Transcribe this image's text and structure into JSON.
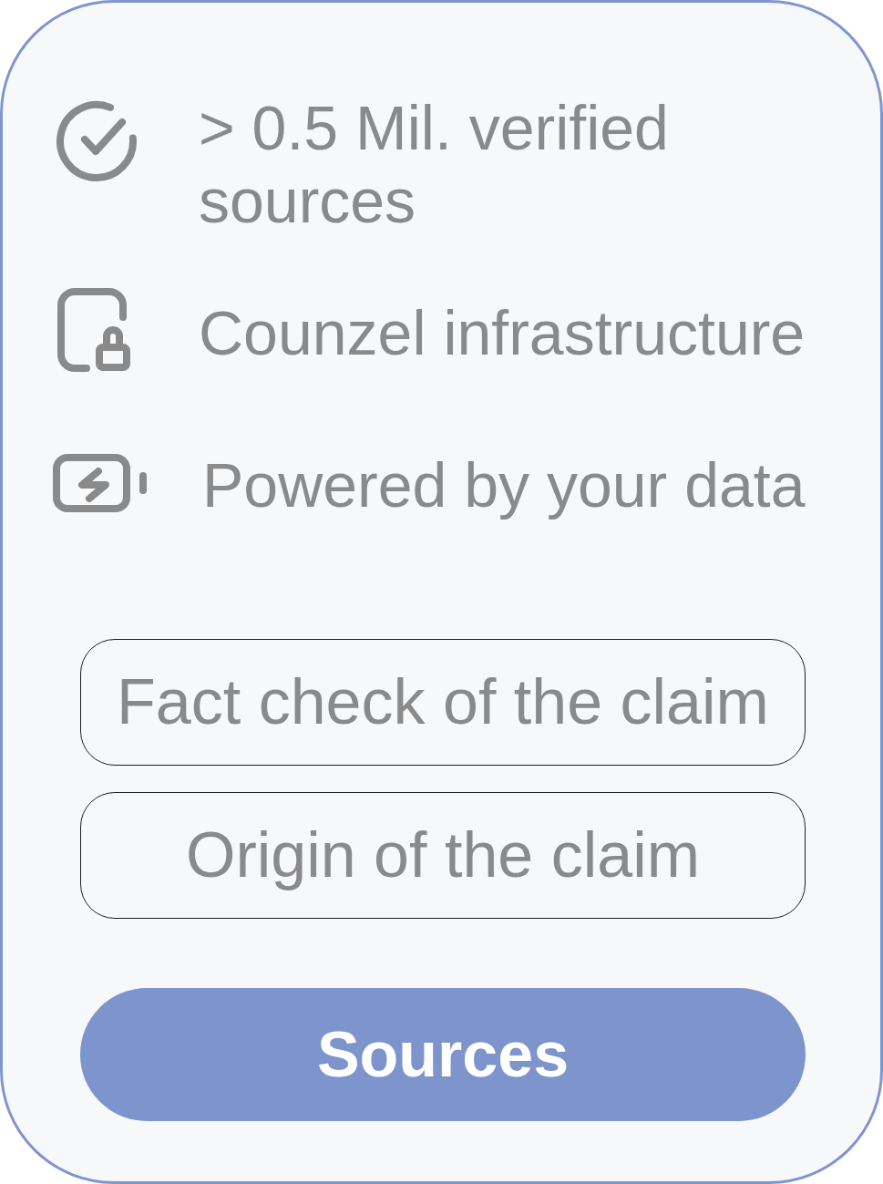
{
  "features": [
    {
      "label": "> 0.5 Mil. verified sources"
    },
    {
      "label": "Counzel infrastructure"
    },
    {
      "label": "Powered by your data"
    }
  ],
  "options": [
    {
      "label": "Fact check of the claim"
    },
    {
      "label": "Origin of the claim"
    }
  ],
  "primary_button": {
    "label": "Sources"
  }
}
